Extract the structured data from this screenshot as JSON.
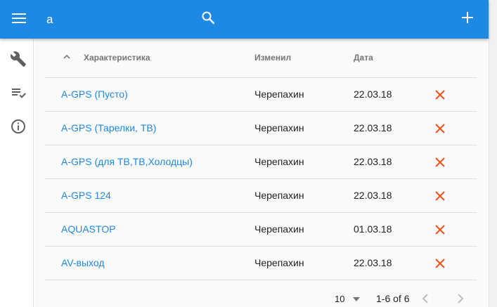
{
  "search": {
    "value": "a"
  },
  "colors": {
    "accent": "#1e88e5",
    "link": "#1e88e5",
    "delete": "#f4511e",
    "muted": "#757575"
  },
  "icons": {
    "menu": "menu-icon",
    "search": "search-icon",
    "add": "plus-icon",
    "sidebar": [
      "wrench-icon",
      "playlist-check-icon",
      "info-icon"
    ],
    "sort": "chevron-up-icon",
    "delete": "close-icon"
  },
  "table": {
    "headers": {
      "name": "Характеристика",
      "user": "Изменил",
      "date": "Дата"
    },
    "rows": [
      {
        "name": "A-GPS (Пусто)",
        "user": "Черепахин",
        "date": "22.03.18"
      },
      {
        "name": "A-GPS (Тарелки, ТВ)",
        "user": "Черепахин",
        "date": "22.03.18"
      },
      {
        "name": "A-GPS (для ТВ,ТВ,Холодцы)",
        "user": "Черепахин",
        "date": "22.03.18"
      },
      {
        "name": "A-GPS 124",
        "user": "Черепахин",
        "date": "22.03.18"
      },
      {
        "name": "AQUASTOP",
        "user": "Черепахин",
        "date": "01.03.18"
      },
      {
        "name": "AV-выход",
        "user": "Черепахин",
        "date": "22.03.18"
      }
    ]
  },
  "pagination": {
    "per_page": "10",
    "range": "1-6 of 6"
  }
}
